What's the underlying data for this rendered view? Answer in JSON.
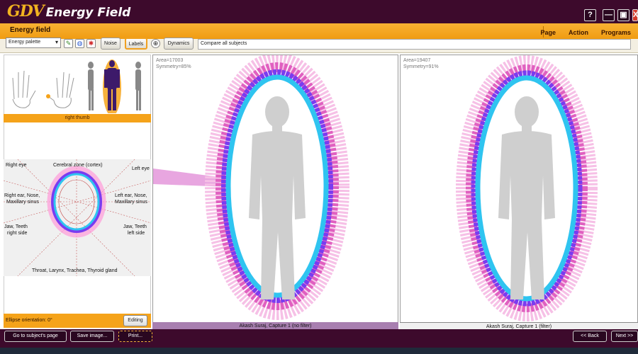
{
  "app": {
    "logo_mark": "GDV",
    "logo_text": "Energy Field"
  },
  "window_buttons": [
    "?",
    "—",
    "▣",
    "X"
  ],
  "header": {
    "title": "Energy field",
    "menu": [
      "Page",
      "Action",
      "Programs"
    ]
  },
  "toolbar": {
    "palette": "Energy palette",
    "noise": "Noise",
    "labels": "Labels",
    "dynamics": "Dynamics",
    "compare": "Compare all subjects"
  },
  "left_panel": {
    "finger": "right thumb",
    "zones": {
      "right_eye": "Right eye",
      "cerebral": "Cerebral zone (cortex)",
      "left_eye": "Left eye",
      "right_ear_1": "Right ear, Nose,",
      "right_ear_2": "Maxillary sinus",
      "left_ear_1": "Left ear, Nose,",
      "left_ear_2": "Maxillary sinus",
      "jaw_right_1": "Jaw, Teeth",
      "jaw_right_2": "right side",
      "jaw_left_1": "Jaw, Teeth",
      "jaw_left_2": "left side",
      "throat": "Throat, Larynx, Trachea, Thyroid gland"
    },
    "ellipse_label": "Ellipse orientation: 0°",
    "editing": "Editing"
  },
  "panels": [
    {
      "area": "Area=17003",
      "symmetry": "Symmetry=85%",
      "caption": "Akash Suraj, Capture 1 (no filter)"
    },
    {
      "area": "Area=19407",
      "symmetry": "Symmetry=91%",
      "caption": "Akash Suraj, Capture 1 (filter)"
    }
  ],
  "bottom": {
    "goto": "Go to subject's page",
    "save": "Save image...",
    "print": "Print...",
    "back": "<< Back",
    "next": "Next >>"
  },
  "colors": {
    "brand_dark": "#3d0a2c",
    "accent": "#f5a31a",
    "aura_inner": "#2fc4f0",
    "aura_mid": "#7a3cf0",
    "aura_outer": "#f08ac8"
  }
}
